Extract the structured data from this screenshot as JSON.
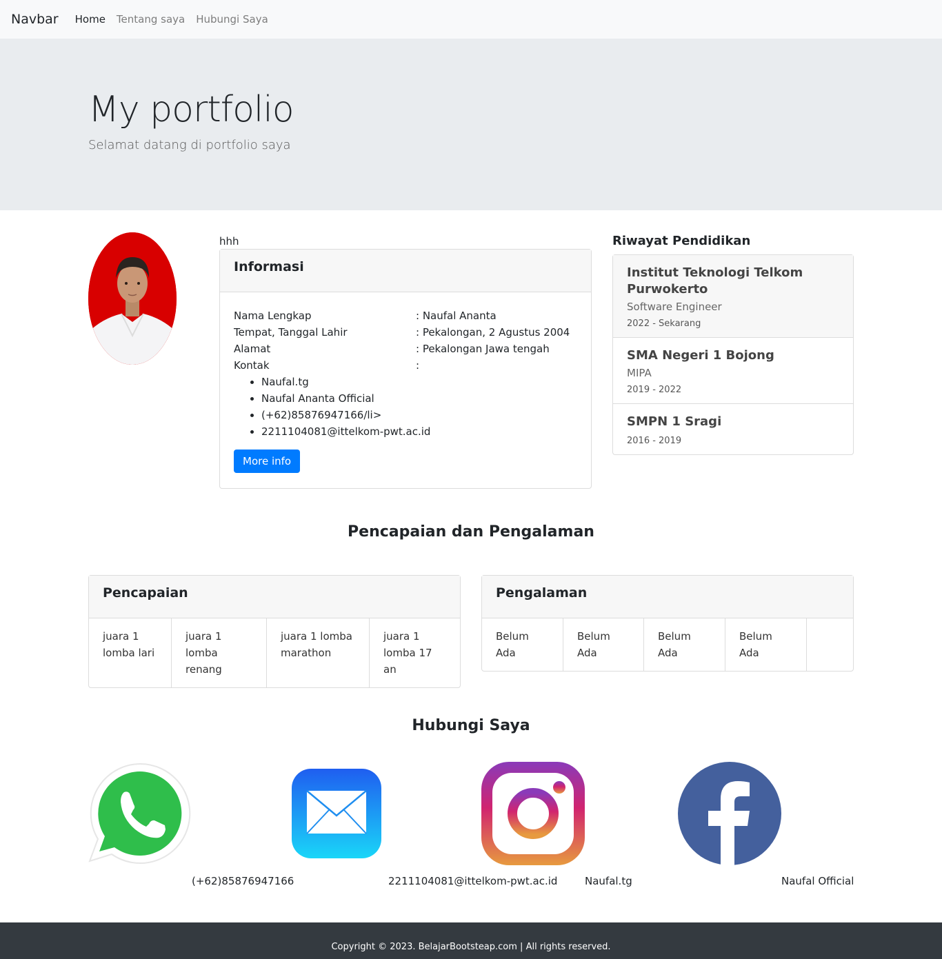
{
  "navbar": {
    "brand": "Navbar",
    "links": [
      "Home",
      "Tentang saya",
      "Hubungi Saya"
    ]
  },
  "hero": {
    "title": "My portfolio",
    "subtitle": "Selamat datang di portfolio saya"
  },
  "profile": {
    "caption": "hhh",
    "info": {
      "title": "Informasi",
      "rows": [
        {
          "label": "Nama Lengkap",
          "value": ": Naufal Ananta"
        },
        {
          "label": "Tempat, Tanggal Lahir",
          "value": ": Pekalongan, 2 Agustus 2004"
        },
        {
          "label": "Alamat",
          "value": ": Pekalongan Jawa tengah"
        },
        {
          "label": "Kontak",
          "value": ":"
        }
      ],
      "contacts": [
        "Naufal.tg",
        "Naufal Ananta Official",
        "(+62)85876947166/li>",
        "2211104081@ittelkom-pwt.ac.id"
      ],
      "button": "More info"
    }
  },
  "education": {
    "title": "Riwayat Pendidikan",
    "items": [
      {
        "school": "Institut Teknologi Telkom Purwokerto",
        "major": "Software Engineer",
        "years": "2022 - Sekarang"
      },
      {
        "school": "SMA Negeri 1 Bojong",
        "major": "MIPA",
        "years": "2019 - 2022"
      },
      {
        "school": "SMPN 1 Sragi",
        "major": "",
        "years": "2016 - 2019"
      }
    ]
  },
  "achievements": {
    "title": "Pencapaian dan Pengalaman",
    "pencapaian": {
      "title": "Pencapaian",
      "items": [
        "juara 1 lomba lari",
        "juara 1 lomba renang",
        "juara 1 lomba marathon",
        "juara 1 lomba 17 an"
      ]
    },
    "pengalaman": {
      "title": "Pengalaman",
      "items": [
        "Belum Ada",
        "Belum Ada",
        "Belum Ada",
        "Belum Ada"
      ]
    }
  },
  "contact": {
    "title": "Hubungi Saya",
    "items": [
      {
        "icon": "whatsapp-icon",
        "label": "(+62)85876947166"
      },
      {
        "icon": "mail-icon",
        "label": "2211104081@ittelkom-pwt.ac.id"
      },
      {
        "icon": "instagram-icon",
        "label": "Naufal.tg"
      },
      {
        "icon": "facebook-icon",
        "label": "Naufal Official"
      }
    ]
  },
  "footer": {
    "text": "Copyright © 2023. BelajarBootsteap.com | All rights reserved."
  },
  "colors": {
    "primary": "#007bff",
    "jumbotron": "#e9ecef",
    "footer": "#343a40",
    "photo_bg": "#d40000"
  }
}
